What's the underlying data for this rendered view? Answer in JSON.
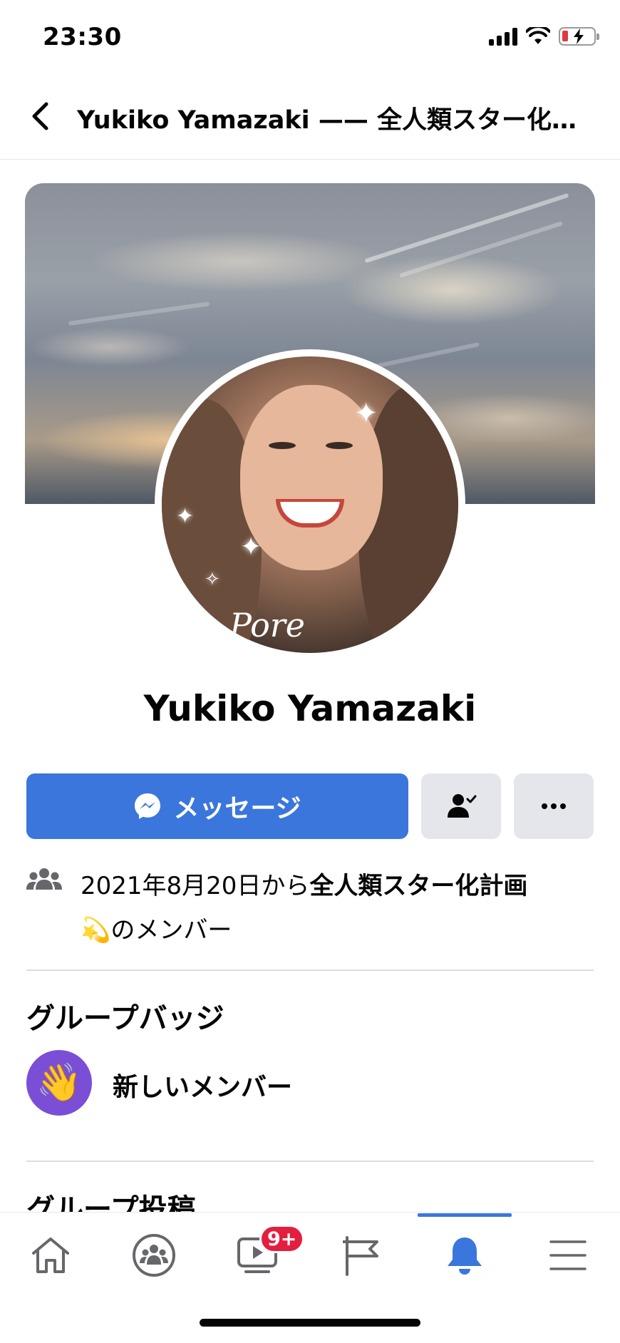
{
  "status_bar": {
    "time": "23:30",
    "signal_icon": "cellular-signal-icon",
    "wifi_icon": "wifi-icon",
    "battery_icon": "battery-low-charging-icon",
    "battery_color": "#e0393e"
  },
  "header": {
    "back_icon": "chevron-left-icon",
    "title": "Yukiko Yamazaki —— 全人類スター化計画"
  },
  "profile": {
    "cover_image": "cloudy-sky-sunset-photo",
    "avatar_image": "smiling-woman-portrait-with-sparkles",
    "avatar_script": "Pore",
    "name": "Yukiko Yamazaki"
  },
  "actions": {
    "message_label": "メッセージ",
    "message_icon": "messenger-icon",
    "friend_icon": "friend-check-icon",
    "more_icon": "more-horizontal-icon",
    "primary_color": "#3b76dc",
    "secondary_color": "#e4e6eb"
  },
  "membership": {
    "icon": "group-members-icon",
    "prefix": "2021年8月20日から",
    "group_name": "全人類スター化計画",
    "emoji": "💫",
    "suffix": "のメンバー"
  },
  "badges": {
    "title": "グループバッジ",
    "items": [
      {
        "icon": "waving-hand-icon",
        "emoji": "👋",
        "label": "新しいメンバー",
        "color": "#7a4fd6"
      }
    ]
  },
  "posts": {
    "title": "グループ投稿"
  },
  "tabbar": {
    "active_tab": "notifications",
    "accent_color": "#3b76dc",
    "tabs": [
      {
        "name": "home",
        "icon": "home-icon"
      },
      {
        "name": "groups",
        "icon": "groups-icon"
      },
      {
        "name": "watch",
        "icon": "video-icon",
        "badge": "9+"
      },
      {
        "name": "pages",
        "icon": "flag-icon"
      },
      {
        "name": "notifications",
        "icon": "bell-icon"
      },
      {
        "name": "menu",
        "icon": "hamburger-menu-icon"
      }
    ]
  }
}
